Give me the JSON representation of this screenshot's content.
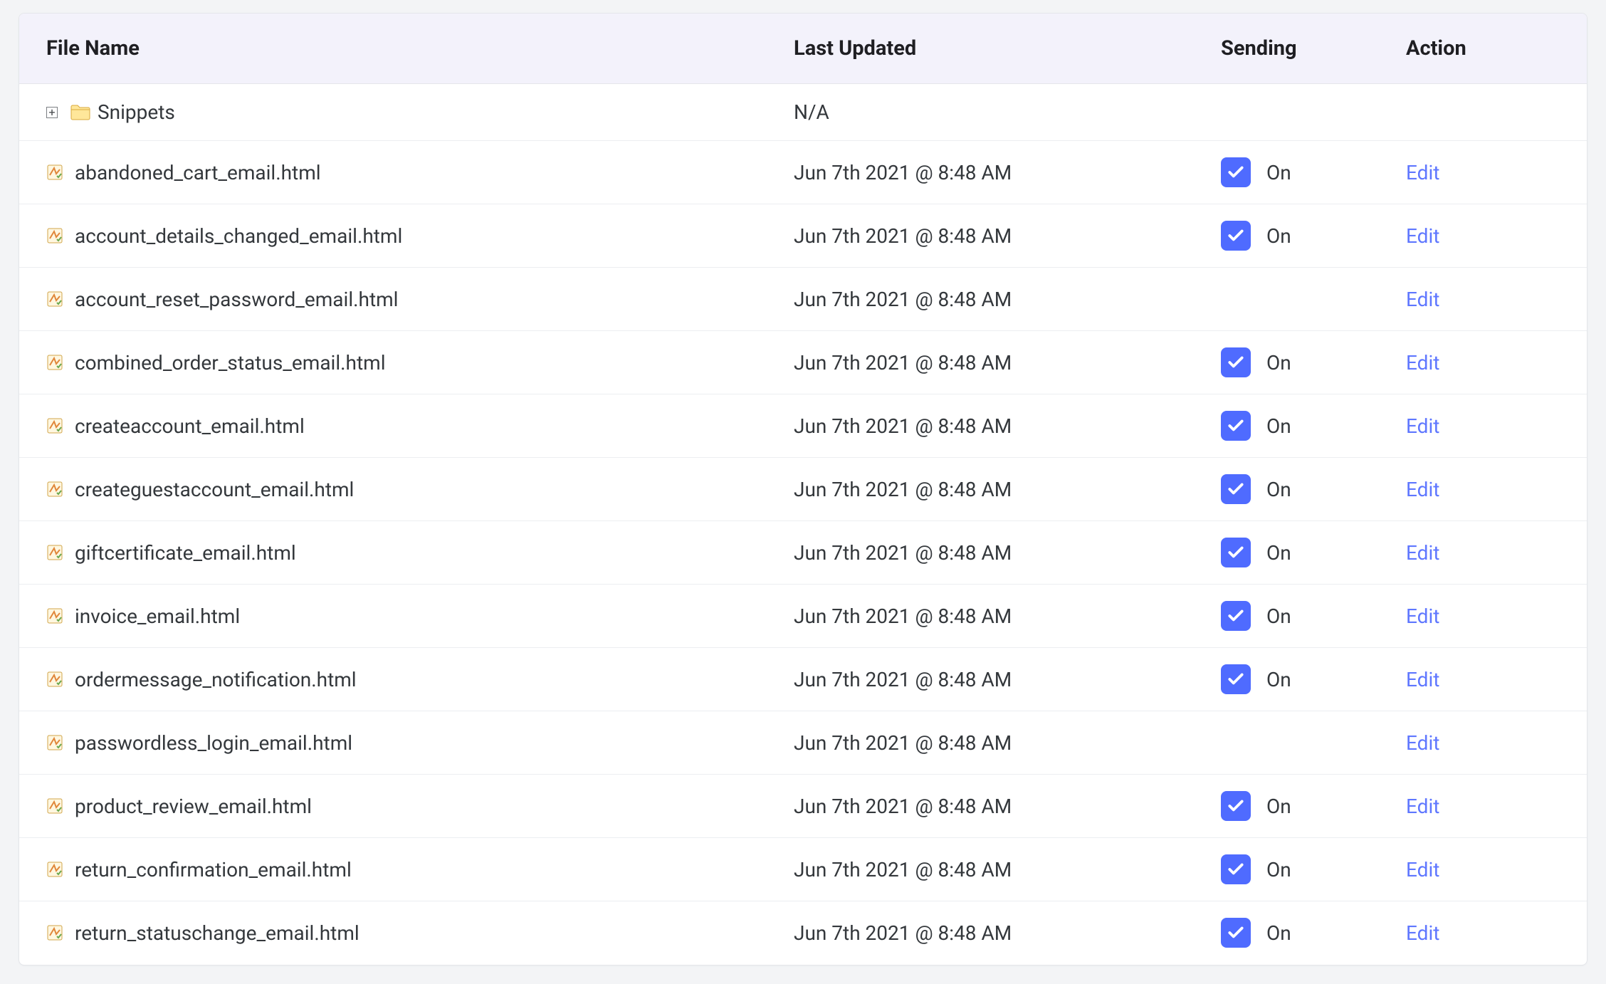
{
  "table": {
    "headers": {
      "file_name": "File Name",
      "last_updated": "Last Updated",
      "sending": "Sending",
      "action": "Action"
    },
    "sending_on_label": "On",
    "edit_label": "Edit",
    "folder_na": "N/A",
    "rows": [
      {
        "type": "folder",
        "name": "Snippets"
      },
      {
        "type": "file",
        "name": "abandoned_cart_email.html",
        "updated": "Jun 7th 2021 @ 8:48 AM",
        "sending": true
      },
      {
        "type": "file",
        "name": "account_details_changed_email.html",
        "updated": "Jun 7th 2021 @ 8:48 AM",
        "sending": true
      },
      {
        "type": "file",
        "name": "account_reset_password_email.html",
        "updated": "Jun 7th 2021 @ 8:48 AM",
        "sending": false
      },
      {
        "type": "file",
        "name": "combined_order_status_email.html",
        "updated": "Jun 7th 2021 @ 8:48 AM",
        "sending": true
      },
      {
        "type": "file",
        "name": "createaccount_email.html",
        "updated": "Jun 7th 2021 @ 8:48 AM",
        "sending": true
      },
      {
        "type": "file",
        "name": "createguestaccount_email.html",
        "updated": "Jun 7th 2021 @ 8:48 AM",
        "sending": true
      },
      {
        "type": "file",
        "name": "giftcertificate_email.html",
        "updated": "Jun 7th 2021 @ 8:48 AM",
        "sending": true
      },
      {
        "type": "file",
        "name": "invoice_email.html",
        "updated": "Jun 7th 2021 @ 8:48 AM",
        "sending": true
      },
      {
        "type": "file",
        "name": "ordermessage_notification.html",
        "updated": "Jun 7th 2021 @ 8:48 AM",
        "sending": true
      },
      {
        "type": "file",
        "name": "passwordless_login_email.html",
        "updated": "Jun 7th 2021 @ 8:48 AM",
        "sending": false
      },
      {
        "type": "file",
        "name": "product_review_email.html",
        "updated": "Jun 7th 2021 @ 8:48 AM",
        "sending": true
      },
      {
        "type": "file",
        "name": "return_confirmation_email.html",
        "updated": "Jun 7th 2021 @ 8:48 AM",
        "sending": true
      },
      {
        "type": "file",
        "name": "return_statuschange_email.html",
        "updated": "Jun 7th 2021 @ 8:48 AM",
        "sending": true
      }
    ]
  }
}
